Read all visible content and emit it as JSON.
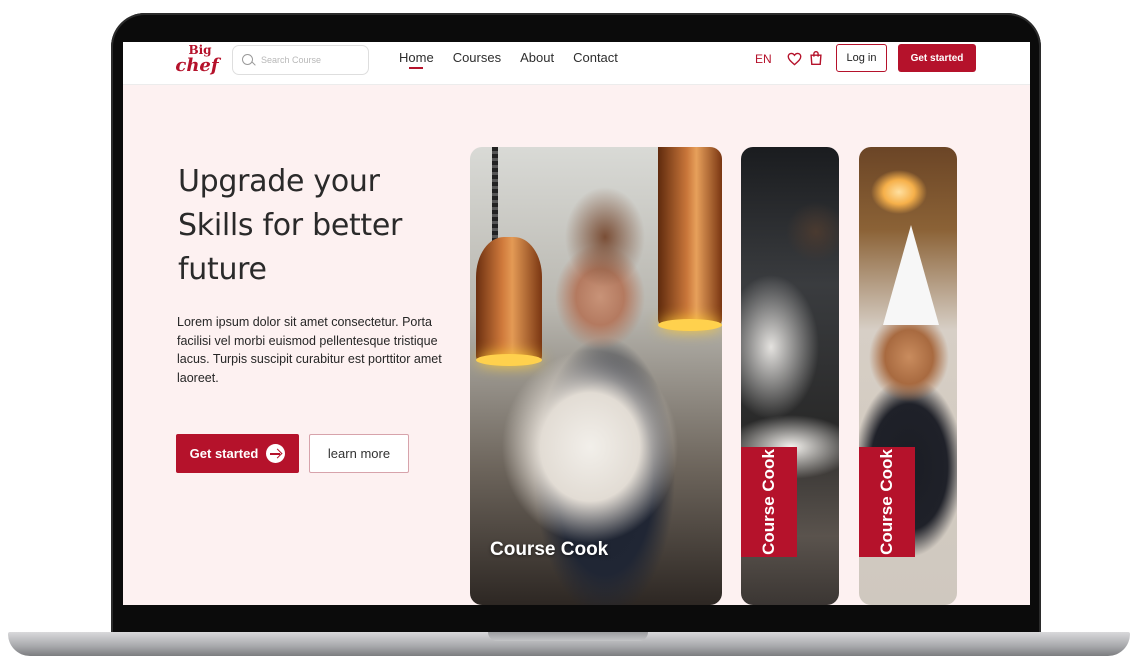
{
  "brand": {
    "logo_line1": "Big",
    "logo_line2": "chef",
    "accent": "#b5122b"
  },
  "search": {
    "placeholder": "Search Course"
  },
  "nav": {
    "links": [
      {
        "label": "Home",
        "active": true
      },
      {
        "label": "Courses",
        "active": false
      },
      {
        "label": "About",
        "active": false
      },
      {
        "label": "Contact",
        "active": false
      }
    ],
    "lang": "EN",
    "login_label": "Log in",
    "cta_label": "Get started"
  },
  "hero": {
    "title": "Upgrade your Skills for better future",
    "description": "Lorem ipsum dolor sit amet consectetur. Porta facilisi vel morbi euismod pellentesque tristique lacus. Turpis suscipit curabitur est porttitor amet laoreet.",
    "primary_button": "Get started",
    "secondary_button": "learn more"
  },
  "cards": [
    {
      "label": "Course Cook"
    },
    {
      "label": "Course Cook"
    },
    {
      "label": "Course Cook"
    }
  ]
}
